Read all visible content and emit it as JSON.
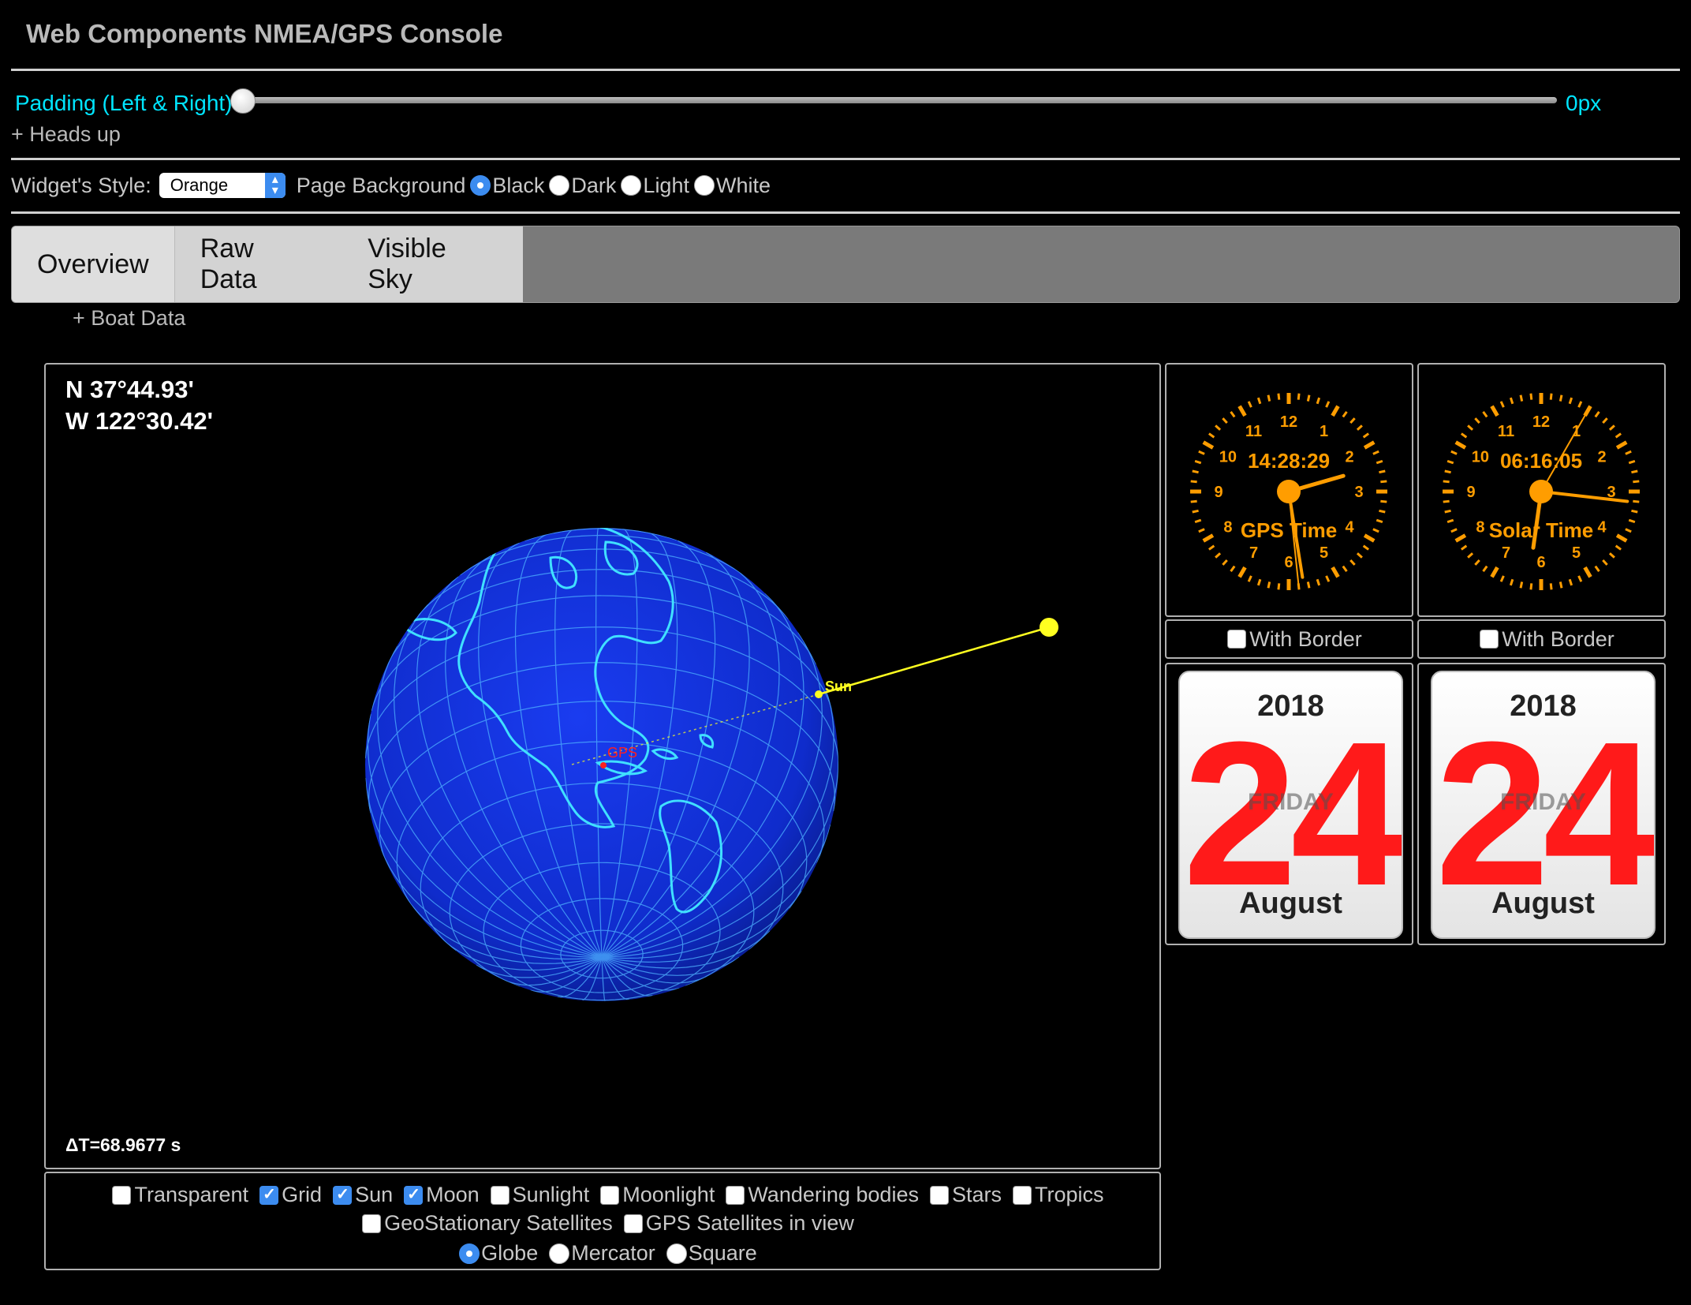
{
  "app": {
    "title": "Web Components NMEA/GPS Console"
  },
  "padding": {
    "label": "Padding (Left & Right)",
    "value": "0px",
    "level_pct": 0
  },
  "headsup": "+ Heads up",
  "style_row": {
    "widget_style_label": "Widget's Style:",
    "widget_style_value": "Orange",
    "page_bg_label": "Page Background",
    "options": [
      {
        "label": "Black",
        "selected": true
      },
      {
        "label": "Dark",
        "selected": false
      },
      {
        "label": "Light",
        "selected": false
      },
      {
        "label": "White",
        "selected": false
      }
    ]
  },
  "tabs": [
    {
      "label": "Overview",
      "active": true
    },
    {
      "label": "Raw Data",
      "active": false
    },
    {
      "label": "Visible Sky",
      "active": false
    }
  ],
  "boat_data": "+ Boat Data",
  "globe": {
    "lat": "N 37°44.93'",
    "lon": "W 122°30.42'",
    "delta_t": "ΔT=68.9677 s",
    "sun_label": "Sun",
    "gps_label": "GPS",
    "colors": {
      "sphere": "#1030d8",
      "grid": "#4fb3ff",
      "land": "#40e0ff",
      "sun": "#ffff20",
      "gps": "#ff2020"
    }
  },
  "options": {
    "checkboxes_line1": [
      {
        "label": "Transparent",
        "checked": false
      },
      {
        "label": "Grid",
        "checked": true
      },
      {
        "label": "Sun",
        "checked": true
      },
      {
        "label": "Moon",
        "checked": true
      },
      {
        "label": "Sunlight",
        "checked": false
      },
      {
        "label": "Moonlight",
        "checked": false
      },
      {
        "label": "Wandering bodies",
        "checked": false
      },
      {
        "label": "Stars",
        "checked": false
      },
      {
        "label": "Tropics",
        "checked": false
      }
    ],
    "checkboxes_line2": [
      {
        "label": "GeoStationary Satellites",
        "checked": false
      },
      {
        "label": "GPS Satellites in view",
        "checked": false
      }
    ],
    "projection": [
      {
        "label": "Globe",
        "selected": true
      },
      {
        "label": "Mercator",
        "selected": false
      },
      {
        "label": "Square",
        "selected": false
      }
    ]
  },
  "clocks": [
    {
      "digital": "14:28:29",
      "caption": "GPS Time",
      "hour": 14,
      "minute": 28,
      "second": 29,
      "border_label": "With Border"
    },
    {
      "digital": "06:16:05",
      "caption": "Solar Time",
      "hour": 6,
      "minute": 16,
      "second": 5,
      "border_label": "With Border"
    }
  ],
  "clock_numbers": [
    "12",
    "1",
    "2",
    "3",
    "4",
    "5",
    "6",
    "7",
    "8",
    "9",
    "10",
    "11"
  ],
  "clock_color": "#ff9d00",
  "calendars": [
    {
      "year": "2018",
      "day": "24",
      "weekday": "FRIDAY",
      "month": "August"
    },
    {
      "year": "2018",
      "day": "24",
      "weekday": "FRIDAY",
      "month": "August"
    }
  ]
}
